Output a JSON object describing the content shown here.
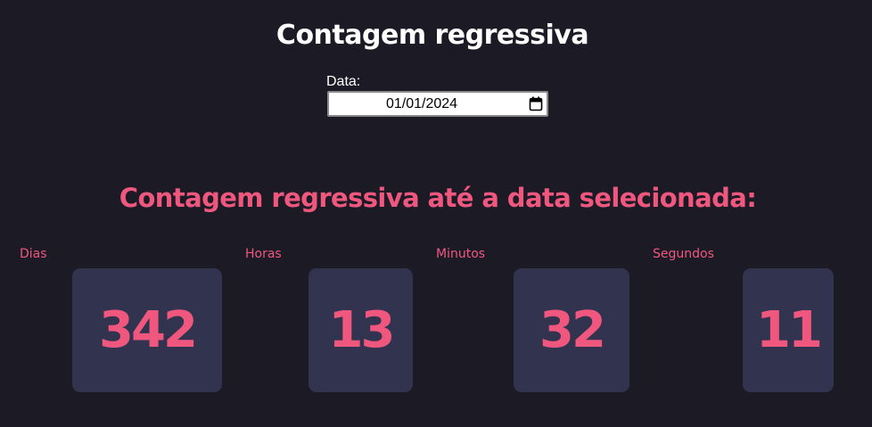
{
  "header": {
    "title": "Contagem regressiva"
  },
  "date_picker": {
    "label": "Data:",
    "value": "01/01/2024"
  },
  "countdown": {
    "heading": "Contagem regressiva até a data selecionada:",
    "units": [
      {
        "label": "Dias",
        "value": "342"
      },
      {
        "label": "Horas",
        "value": "13"
      },
      {
        "label": "Minutos",
        "value": "32"
      },
      {
        "label": "Segundos",
        "value": "11"
      }
    ]
  },
  "colors": {
    "background": "#1c1b25",
    "accent": "#f0577f",
    "box": "#32334e",
    "title": "#ffffff"
  },
  "icons": {
    "date_picker": "calendar-icon"
  }
}
